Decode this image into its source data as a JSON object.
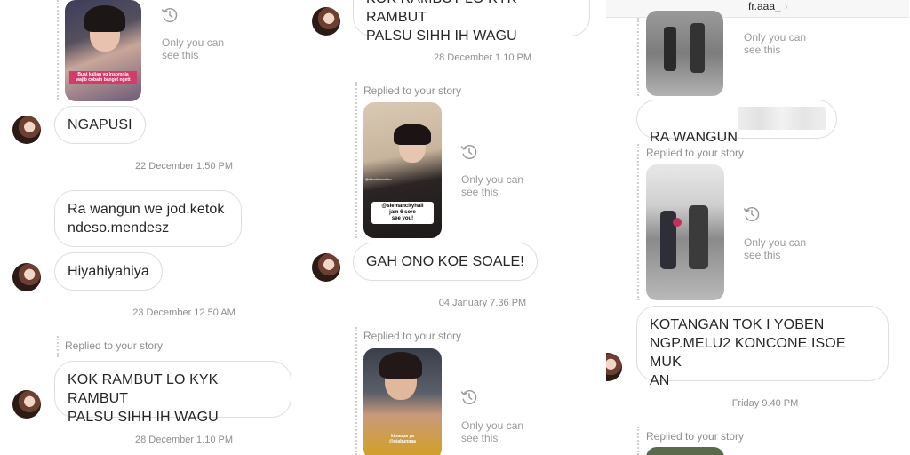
{
  "panel1": {
    "thumb_caption": "Buat kalian yg insomnia\nwajib cobain banget ngett",
    "only_you_can_see": "Only you can\nsee this",
    "msg_ngapusi": "NGAPUSI",
    "stamp1": "22 December 1.50 PM",
    "msg_ra_wangun": "Ra wangun we jod.ketok\nndeso.mendesz",
    "msg_hiyahiya": "Hiyahiyahiya",
    "stamp2": "23 December 12.50 AM",
    "replied_label": "Replied to your story",
    "msg_kok_rambut": "KOK RAMBUT LO KYK RAMBUT\nPALSU SIHH IH WAGU",
    "stamp3": "28 December 1.10 PM"
  },
  "panel2": {
    "msg_top_partial": "KOK RAMBUT LO KYK RAMBUT\nPALSU SIHH IH WAGU",
    "stamp1": "28 December 1.10 PM",
    "replied_label1": "Replied to your story",
    "sticker_handle": "@slemancityhall\njam 6 sore\nsee you!",
    "side_handle": "@devdanondoro",
    "only_you_can_see1": "Only you can\nsee this",
    "msg_gah_ono": "GAH ONO KOE SOALE!",
    "stamp2": "04 January 7.36 PM",
    "replied_label2": "Replied to your story",
    "thumb2_caption": "kinaupa ya\n@ojabungaa",
    "only_you_can_see2": "Only you can\nsee this"
  },
  "panel3": {
    "header_title": "fr.aaa_",
    "only_you_can_see1": "Only you can\nsee this",
    "msg_ra_wangun": "RA WANGUN",
    "replied_label1": "Replied to your story",
    "only_you_can_see2": "Only you can\nsee this",
    "msg_kotangan": "KOTANGAN TOK I YOBEN\nNGP.MELU2 KONCONE ISOE MUK\nAN",
    "stamp1": "Friday 9.40 PM",
    "replied_label2": "Replied to your story"
  },
  "icons": {
    "clock": "history-clock-icon",
    "chevron": "chevron-right-icon"
  },
  "colors": {
    "bubble_border": "#dedede",
    "meta_text": "#8e8e8e",
    "message_text": "#262626"
  }
}
